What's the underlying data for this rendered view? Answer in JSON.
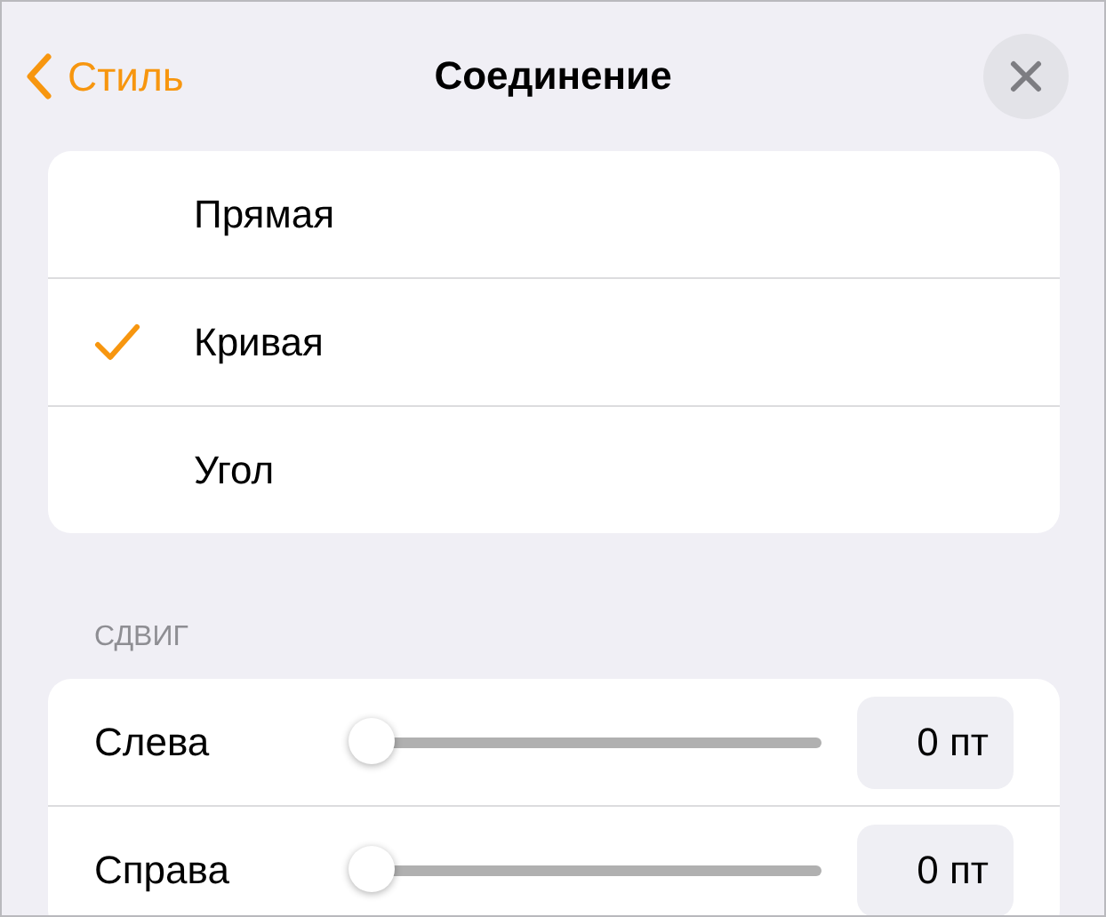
{
  "header": {
    "back": "Стиль",
    "title": "Соединение"
  },
  "options": [
    {
      "label": "Прямая",
      "selected": false
    },
    {
      "label": "Кривая",
      "selected": true
    },
    {
      "label": "Угол",
      "selected": false
    }
  ],
  "offset": {
    "heading": "СДВИГ",
    "sliders": [
      {
        "label": "Слева",
        "level": 0,
        "value": "0 пт"
      },
      {
        "label": "Справа",
        "level": 0,
        "value": "0 пт"
      }
    ]
  }
}
